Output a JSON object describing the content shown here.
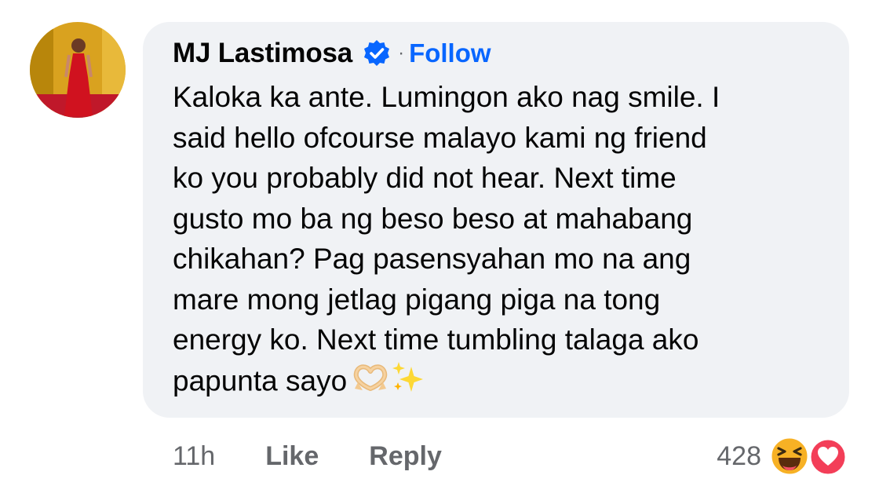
{
  "comment": {
    "author": "MJ Lastimosa",
    "follow_separator": "·",
    "follow_label": "Follow",
    "text_lines": [
      "Kaloka ka ante. Lumingon ako nag smile. I",
      "said hello ofcourse malayo kami ng friend",
      "ko you probably did not hear. Next time",
      "gusto mo ba ng beso beso at mahabang",
      "chikahan? Pag pasensyahan mo na ang",
      "mare mong jetlag pigang piga na tong",
      "energy ko. Next time tumbling talaga ako",
      "papunta sayo"
    ],
    "trailing_emojis": [
      "heart-hands-emoji",
      "sparkles-emoji"
    ],
    "timestamp": "11h",
    "like_label": "Like",
    "reply_label": "Reply",
    "reaction_count": "428",
    "reaction_icons": [
      "haha-reaction-icon",
      "love-reaction-icon"
    ]
  },
  "colors": {
    "bubble_bg": "#f0f2f5",
    "follow": "#0866ff",
    "verified_badge": "#0866ff",
    "meta_text": "#65676b",
    "love": "#f33e58",
    "haha": "#f7b125"
  }
}
